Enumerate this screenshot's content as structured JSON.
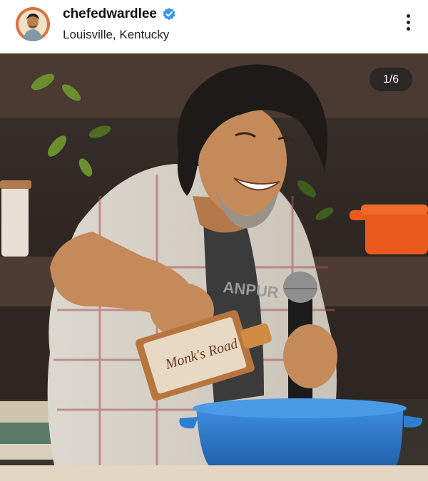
{
  "post": {
    "username": "chefedwardlee",
    "location": "Louisville, Kentucky",
    "verified": true,
    "counter": "1/6"
  },
  "photo": {
    "bottle_label": "Monk's Road",
    "shirt_text": "ANPUR"
  },
  "icons": {
    "verified": "verified-badge-icon",
    "more": "more-options-icon"
  },
  "colors": {
    "verified_blue": "#3897f0",
    "pot_blue": "#2f7fd1",
    "pot_orange": "#ea5a1e"
  }
}
